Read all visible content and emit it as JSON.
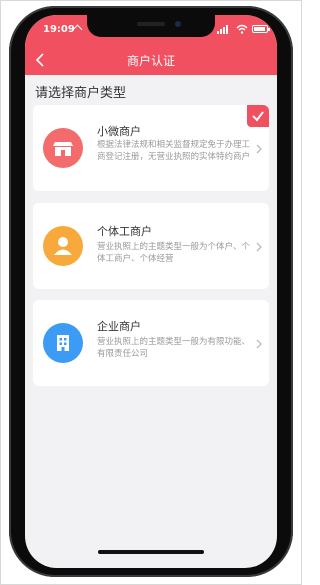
{
  "status": {
    "time": "19:09"
  },
  "nav": {
    "title": "商户认证"
  },
  "prompt": "请选择商户类型",
  "cards": [
    {
      "title": "小微商户",
      "desc": "根据法律法规和相关监督规定免于办理工商登记注册，无营业执照的实体特约商户",
      "icon": "storefront-icon",
      "color": "#f36b6b",
      "selected": true
    },
    {
      "title": "个体工商户",
      "desc": "营业执照上的主题类型一般为个体户、个体工商户、个体经营",
      "icon": "person-icon",
      "color": "#f7a93c",
      "selected": false
    },
    {
      "title": "企业商户",
      "desc": "营业执照上的主题类型一般为有限功能、有限责任公司",
      "icon": "building-icon",
      "color": "#3b9bf5",
      "selected": false
    }
  ]
}
